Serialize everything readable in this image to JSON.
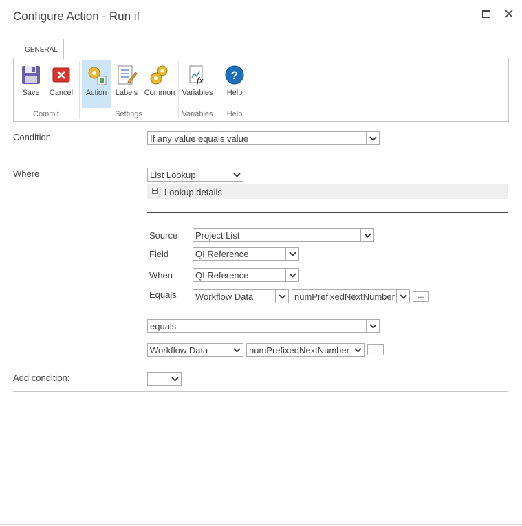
{
  "dialog": {
    "title": "Configure Action - Run if"
  },
  "ribbon": {
    "tab": "GENERAL",
    "buttons": {
      "save": "Save",
      "cancel": "Cancel",
      "action": "Action",
      "labels": "Labels",
      "common": "Common",
      "variables": "Variables",
      "help": "Help"
    },
    "groups": {
      "commit": "Commit",
      "settings": "Settings",
      "variables": "Variables",
      "help": "Help"
    }
  },
  "form": {
    "condition_label": "Condition",
    "condition_value": "If any value equals value",
    "where_label": "Where",
    "where_value": "List Lookup",
    "lookup_details": "Lookup details",
    "source_label": "Source",
    "source_value": "Project List",
    "field_label": "Field",
    "field_value": "QI Reference",
    "when_label": "When",
    "when_value": "QI Reference",
    "equals_label": "Equals",
    "equals_type": "Workflow Data",
    "equals_var": "numPrefixedNextNumber",
    "equals_dots": "...",
    "operator_value": "equals",
    "value_type": "Workflow Data",
    "value_var": "numPrefixedNextNumber",
    "value_dots": "...",
    "add_condition_label": "Add condition:",
    "add_condition_value": ""
  },
  "colors": {
    "active_tab": "#cde6f7",
    "border": "#c6c6c6",
    "help_blue": "#1e6fb8",
    "cancel_red": "#d9342b"
  }
}
